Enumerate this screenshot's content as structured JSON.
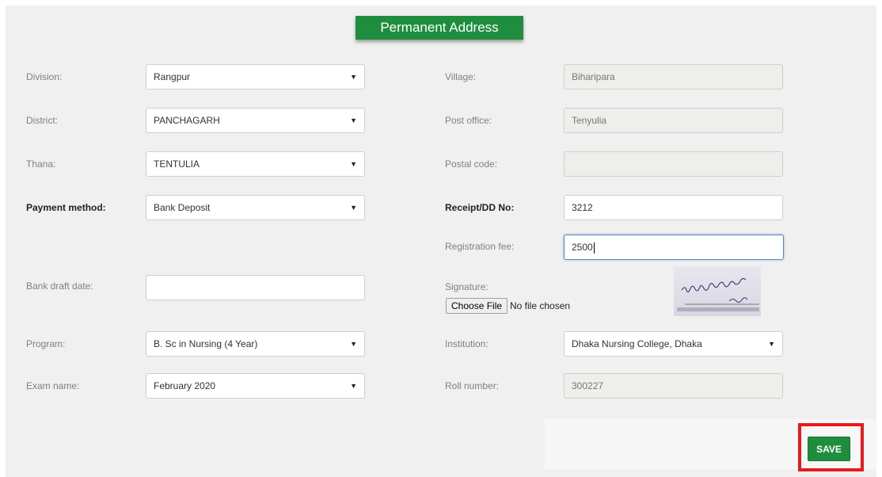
{
  "section_title": "Permanent Address",
  "left": {
    "division": {
      "label": "Division:",
      "value": "Rangpur"
    },
    "district": {
      "label": "District:",
      "value": "PANCHAGARH"
    },
    "thana": {
      "label": "Thana:",
      "value": "TENTULIA"
    },
    "payment_method": {
      "label": "Payment method:",
      "value": "Bank Deposit"
    },
    "bank_draft_date": {
      "label": "Bank draft date:",
      "value": ""
    },
    "program": {
      "label": "Program:",
      "value": "B. Sc in Nursing (4 Year)"
    },
    "exam_name": {
      "label": "Exam name:",
      "value": "February 2020"
    }
  },
  "right": {
    "village": {
      "label": "Village:",
      "value": "Biharipara"
    },
    "post_office": {
      "label": "Post office:",
      "value": "Tenyulia"
    },
    "postal_code": {
      "label": "Postal code:",
      "value": ""
    },
    "receipt": {
      "label": "Receipt/DD No:",
      "value": "3212"
    },
    "registration_fee": {
      "label": "Registration fee:",
      "value": "2500"
    },
    "signature": {
      "label": "Signature:",
      "choose_file": "Choose File",
      "file_status": "No file chosen"
    },
    "institution": {
      "label": "Institution:",
      "value": "Dhaka Nursing College, Dhaka"
    },
    "roll_number": {
      "label": "Roll number:",
      "value": "300227"
    }
  },
  "save_label": "SAVE",
  "colors": {
    "accent": "#1e8e3e",
    "highlight": "#e8191b",
    "focus": "#5b86c5"
  },
  "icons": {
    "caret": "caret-down-icon"
  }
}
